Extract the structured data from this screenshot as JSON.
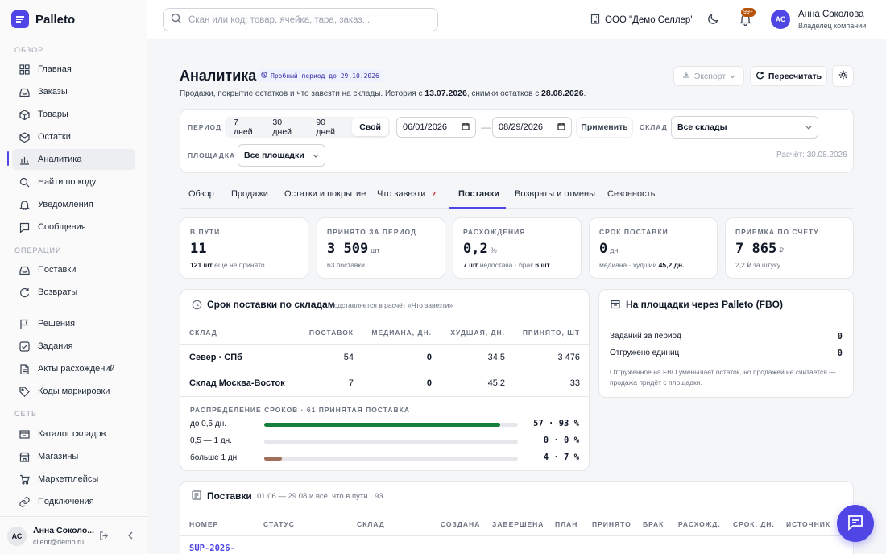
{
  "app": {
    "name": "Palleto"
  },
  "sidebar": {
    "sections": {
      "overview": "ОБЗОР",
      "operations": "ОПЕРАЦИИ",
      "network": "СЕТЬ"
    },
    "items": [
      {
        "label": "Главная",
        "icon": "grid-icon"
      },
      {
        "label": "Заказы",
        "icon": "inbox-icon"
      },
      {
        "label": "Товары",
        "icon": "box-icon"
      },
      {
        "label": "Остатки",
        "icon": "cube-icon"
      },
      {
        "label": "Аналитика",
        "icon": "bar-chart-icon"
      },
      {
        "label": "Найти по коду",
        "icon": "search-icon"
      },
      {
        "label": "Уведомления",
        "icon": "bell-icon"
      },
      {
        "label": "Сообщения",
        "icon": "message-icon"
      },
      {
        "label": "Поставки",
        "icon": "inbox-icon"
      },
      {
        "label": "Возвраты",
        "icon": "refresh-icon"
      },
      {
        "label": "Решения",
        "icon": "flag-icon"
      },
      {
        "label": "Задания",
        "icon": "check-icon"
      },
      {
        "label": "Акты расхождений",
        "icon": "file-icon"
      },
      {
        "label": "Коды маркировки",
        "icon": "tag-icon"
      },
      {
        "label": "Каталог складов",
        "icon": "warehouse-icon"
      },
      {
        "label": "Магазины",
        "icon": "store-icon"
      },
      {
        "label": "Маркетплейсы",
        "icon": "cart-icon"
      },
      {
        "label": "Подключения",
        "icon": "link-icon"
      }
    ],
    "user": {
      "initials": "АС",
      "name": "Анна Соколо...",
      "email": "client@demo.ru"
    }
  },
  "topbar": {
    "search_placeholder": "Скан или код: товар, ячейка, тара, заказ...",
    "company": "ООО \"Демо Селлер\"",
    "notif_badge": "99+",
    "user_initials": "АС",
    "user_name": "Анна Соколова",
    "user_role": "Владелец компании"
  },
  "page": {
    "title": "Аналитика",
    "trial": "Пробный период до 29.10.2026",
    "subtitle_a": "Продажи, покрытие остатков и что завезти на склады. История с ",
    "subtitle_date1": "13.07.2026",
    "subtitle_b": ", снимки остатков с ",
    "subtitle_date2": "28.08.2026",
    "subtitle_c": ".",
    "export": "Экспорт",
    "recalc": "Пересчитать"
  },
  "filters": {
    "period_label": "ПЕРИОД",
    "periods": [
      "7 дней",
      "30 дней",
      "90 дней",
      "Свой"
    ],
    "date_from": "06/01/2026",
    "date_to": "08/29/2026",
    "apply": "Применить",
    "warehouse_label": "СКЛАД",
    "warehouse_value": "Все склады",
    "platform_label": "ПЛОЩАДКА",
    "platform_value": "Все площадки",
    "calc": "Расчёт: 30.08.2026"
  },
  "tabs": [
    {
      "label": "Обзор"
    },
    {
      "label": "Продажи"
    },
    {
      "label": "Остатки и покрытие"
    },
    {
      "label": "Что завезти",
      "badge": "2"
    },
    {
      "label": "Поставки"
    },
    {
      "label": "Возвраты и отмены"
    },
    {
      "label": "Сезонность"
    }
  ],
  "kpis": [
    {
      "label": "В ПУТИ",
      "value": "11",
      "unit": "",
      "sub_bold": "121 шт",
      "sub": "ещё не принято"
    },
    {
      "label": "ПРИНЯТО ЗА ПЕРИОД",
      "value": "3 509",
      "unit": "шт",
      "sub_bold": "",
      "sub": "63 поставки"
    },
    {
      "label": "РАСХОЖДЕНИЯ",
      "value": "0,2",
      "unit": "%",
      "sub_bold": "7 шт",
      "sub": "недостача · брак",
      "sub_bold2": "6 шт"
    },
    {
      "label": "СРОК ПОСТАВКИ",
      "value": "0",
      "unit": "дн.",
      "sub_bold": "",
      "sub": "медиана · худший",
      "sub_bold2": "45,2 дн."
    },
    {
      "label": "ПРИЁМКА ПО СЧЁТУ",
      "value": "7 865",
      "unit": "₽",
      "sub_bold": "",
      "sub": "2,2 ₽ за штуку"
    }
  ],
  "lead": {
    "title": "Срок поставки по складам",
    "note": "подставляется в расчёт «Что завезти»",
    "headers": [
      "СКЛАД",
      "ПОСТАВОК",
      "МЕДИАНА, ДН.",
      "ХУДШАЯ, ДН.",
      "ПРИНЯТО, ШТ"
    ],
    "rows": [
      [
        "Север · СПб",
        "54",
        "0",
        "34,5",
        "3 476"
      ],
      [
        "Склад Москва-Восток",
        "7",
        "0",
        "45,2",
        "33"
      ]
    ],
    "dist_title": "РАСПРЕДЕЛЕНИЕ СРОКОВ · 61 ПРИНЯТАЯ ПОСТАВКА",
    "dist": [
      {
        "label": "до 0,5 дн.",
        "count": "57",
        "pct": "93 %",
        "frac": 0.93,
        "color": "#15803d"
      },
      {
        "label": "0,5 — 1 дн.",
        "count": "0",
        "pct": "0 %",
        "frac": 0.0,
        "color": "#15803d"
      },
      {
        "label": "больше 1 дн.",
        "count": "4",
        "pct": "7 %",
        "frac": 0.07,
        "color": "#a16e5a"
      }
    ]
  },
  "fbo": {
    "title": "На площадки через Palleto (FBO)",
    "rows": [
      [
        "Заданий за период",
        "0"
      ],
      [
        "Отгружено единиц",
        "0"
      ]
    ],
    "note": "Отгруженное на FBO уменьшает остаток, но продажей не считается — продажа придёт с площадки."
  },
  "supplies": {
    "title": "Поставки",
    "note": "01.06 — 29.08 и всё, что в пути · 93",
    "headers": [
      "НОМЕР",
      "СТАТУС",
      "СКЛАД",
      "СОЗДАНА",
      "ЗАВЕРШЕНА",
      "ПЛАН",
      "ПРИНЯТО",
      "БРАК",
      "РАСХОЖД.",
      "СРОК, ДН.",
      "ИСТОЧНИК"
    ],
    "first_row_number": "SUP-2026-"
  },
  "colors": {
    "accent": "#4f46e5",
    "good": "#15803d",
    "bad": "#a16e5a"
  }
}
